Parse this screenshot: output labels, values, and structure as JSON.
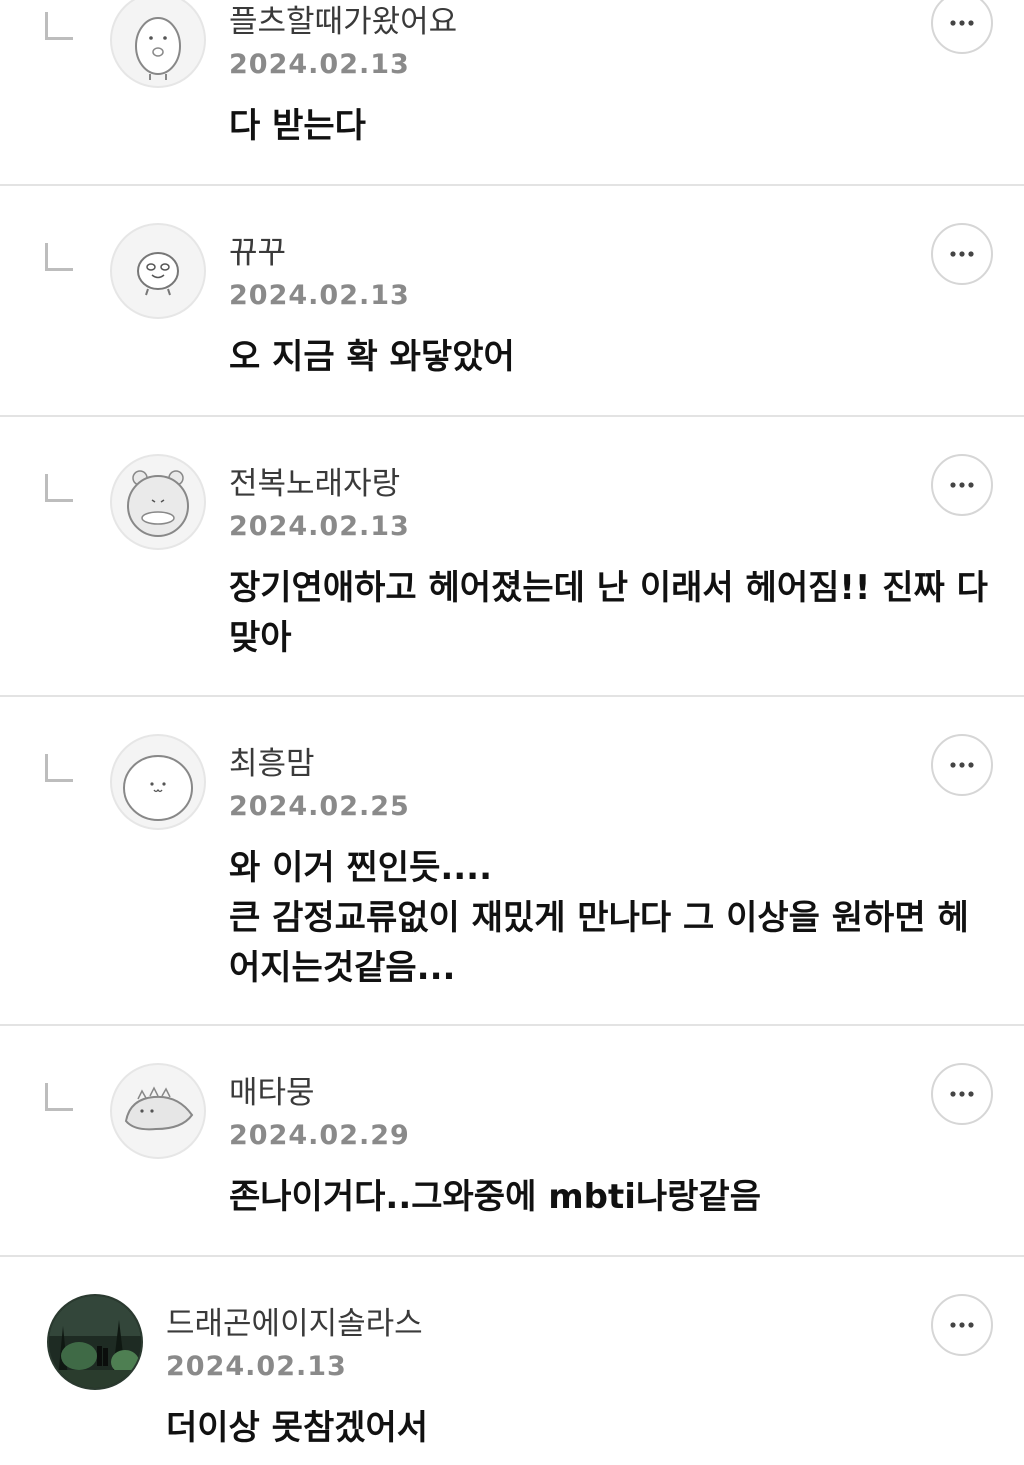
{
  "comments": [
    {
      "author": "플츠할때가왔어요",
      "date": "2024.02.13",
      "text": "다 받는다",
      "avatar_icon": "penguin-character-icon",
      "reply": true
    },
    {
      "author": "뀨꾸",
      "date": "2024.02.13",
      "text": "오 지금 확 와닿았어",
      "avatar_icon": "bird-character-icon",
      "reply": true
    },
    {
      "author": "전복노래자랑",
      "date": "2024.02.13",
      "text": "장기연애하고 헤어졌는데 난 이래서 헤어짐!! 진짜 다\n맞아",
      "avatar_icon": "bear-character-icon",
      "reply": true
    },
    {
      "author": "최흥맘",
      "date": "2024.02.25",
      "text": "와 이거 찐인듯....\n큰 감정교류없이 재밌게 만나다 그 이상을 원하면 헤\n어지는것같음...",
      "avatar_icon": "round-character-icon",
      "reply": true
    },
    {
      "author": "매타뭉",
      "date": "2024.02.29",
      "text": "존나이거다..그와중에 mbti나랑같음",
      "avatar_icon": "dinosaur-character-icon",
      "reply": true
    },
    {
      "author": "드래곤에이지솔라스",
      "date": "2024.02.13",
      "text": "더이상 못참겠어서",
      "avatar_icon": "forest-photo-avatar",
      "reply": false
    }
  ],
  "more_icon": "more-options-icon",
  "colors": {
    "divider": "#e3e3e3",
    "date": "#8a8a8a",
    "text": "#111111"
  }
}
